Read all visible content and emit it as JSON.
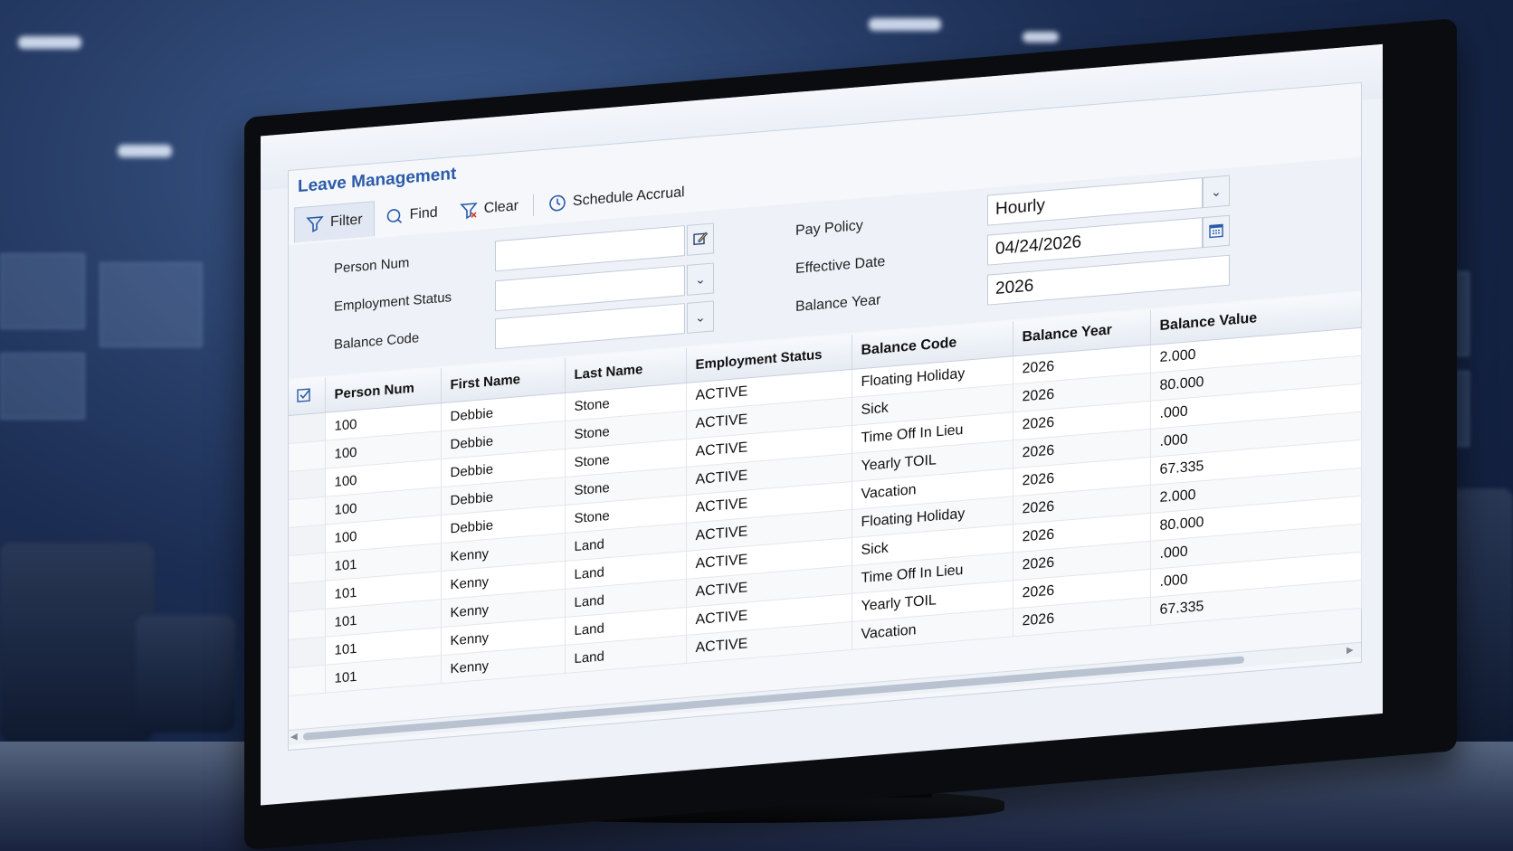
{
  "app": {
    "title": "Leave Management"
  },
  "toolbar": {
    "filter_label": "Filter",
    "find_label": "Find",
    "clear_label": "Clear",
    "schedule_label": "Schedule Accrual"
  },
  "form": {
    "person_num": {
      "label": "Person Num",
      "value": ""
    },
    "employment_status": {
      "label": "Employment Status",
      "value": ""
    },
    "balance_code": {
      "label": "Balance Code",
      "value": ""
    },
    "pay_policy": {
      "label": "Pay Policy",
      "value": "Hourly"
    },
    "effective_date": {
      "label": "Effective Date",
      "value": "04/24/2026"
    },
    "balance_year": {
      "label": "Balance Year",
      "value": "2026"
    }
  },
  "table": {
    "columns": [
      "Person Num",
      "First Name",
      "Last Name",
      "Employment Status",
      "Balance Code",
      "Balance Year",
      "Balance Value"
    ],
    "rows": [
      [
        "100",
        "Debbie",
        "Stone",
        "ACTIVE",
        "Floating Holiday",
        "2026",
        "2.000"
      ],
      [
        "100",
        "Debbie",
        "Stone",
        "ACTIVE",
        "Sick",
        "2026",
        "80.000"
      ],
      [
        "100",
        "Debbie",
        "Stone",
        "ACTIVE",
        "Time Off In Lieu",
        "2026",
        ".000"
      ],
      [
        "100",
        "Debbie",
        "Stone",
        "ACTIVE",
        "Yearly TOIL",
        "2026",
        ".000"
      ],
      [
        "100",
        "Debbie",
        "Stone",
        "ACTIVE",
        "Vacation",
        "2026",
        "67.335"
      ],
      [
        "101",
        "Kenny",
        "Land",
        "ACTIVE",
        "Floating Holiday",
        "2026",
        "2.000"
      ],
      [
        "101",
        "Kenny",
        "Land",
        "ACTIVE",
        "Sick",
        "2026",
        "80.000"
      ],
      [
        "101",
        "Kenny",
        "Land",
        "ACTIVE",
        "Time Off In Lieu",
        "2026",
        ".000"
      ],
      [
        "101",
        "Kenny",
        "Land",
        "ACTIVE",
        "Yearly TOIL",
        "2026",
        ".000"
      ],
      [
        "101",
        "Kenny",
        "Land",
        "ACTIVE",
        "Vacation",
        "2026",
        "67.335"
      ]
    ]
  },
  "colors": {
    "title": "#2b5ba8",
    "accent": "#26406e"
  }
}
